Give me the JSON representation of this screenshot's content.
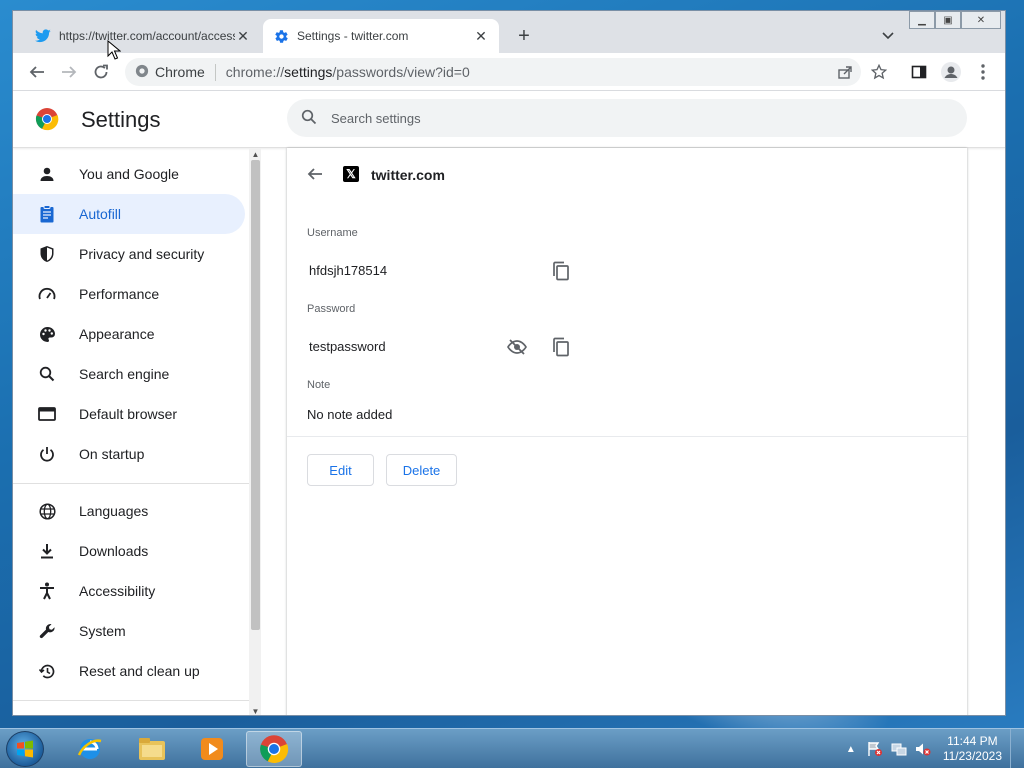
{
  "browser": {
    "tabs": [
      {
        "title": "https://twitter.com/account/access",
        "active": false
      },
      {
        "title": "Settings - twitter.com",
        "active": true
      }
    ],
    "omnibox": {
      "chip_label": "Chrome",
      "url_prefix": "chrome://",
      "url_host": "settings",
      "url_path": "/passwords/view?id=0"
    }
  },
  "settings": {
    "title": "Settings",
    "search_placeholder": "Search settings",
    "nav": [
      {
        "label": "You and Google",
        "icon": "person-icon"
      },
      {
        "label": "Autofill",
        "icon": "clipboard-icon",
        "active": true
      },
      {
        "label": "Privacy and security",
        "icon": "shield-icon"
      },
      {
        "label": "Performance",
        "icon": "speedometer-icon"
      },
      {
        "label": "Appearance",
        "icon": "palette-icon"
      },
      {
        "label": "Search engine",
        "icon": "search-icon"
      },
      {
        "label": "Default browser",
        "icon": "browser-icon"
      },
      {
        "label": "On startup",
        "icon": "power-icon"
      },
      {
        "label": "Languages",
        "icon": "globe-icon"
      },
      {
        "label": "Downloads",
        "icon": "download-icon"
      },
      {
        "label": "Accessibility",
        "icon": "accessibility-icon"
      },
      {
        "label": "System",
        "icon": "wrench-icon"
      },
      {
        "label": "Reset and clean up",
        "icon": "history-icon"
      }
    ]
  },
  "password_detail": {
    "site": "twitter.com",
    "username_label": "Username",
    "username": "hfdsjh178514",
    "password_label": "Password",
    "password": "testpassword",
    "note_label": "Note",
    "note": "No note added",
    "edit_label": "Edit",
    "delete_label": "Delete"
  },
  "taskbar": {
    "time": "11:44 PM",
    "date": "11/23/2023",
    "apps": [
      "internet-explorer-icon",
      "file-explorer-icon",
      "media-player-icon",
      "chrome-icon"
    ]
  },
  "colors": {
    "accent": "#1a73e8",
    "active_nav_bg": "#e8f0fe",
    "active_nav_text": "#1967d2"
  }
}
